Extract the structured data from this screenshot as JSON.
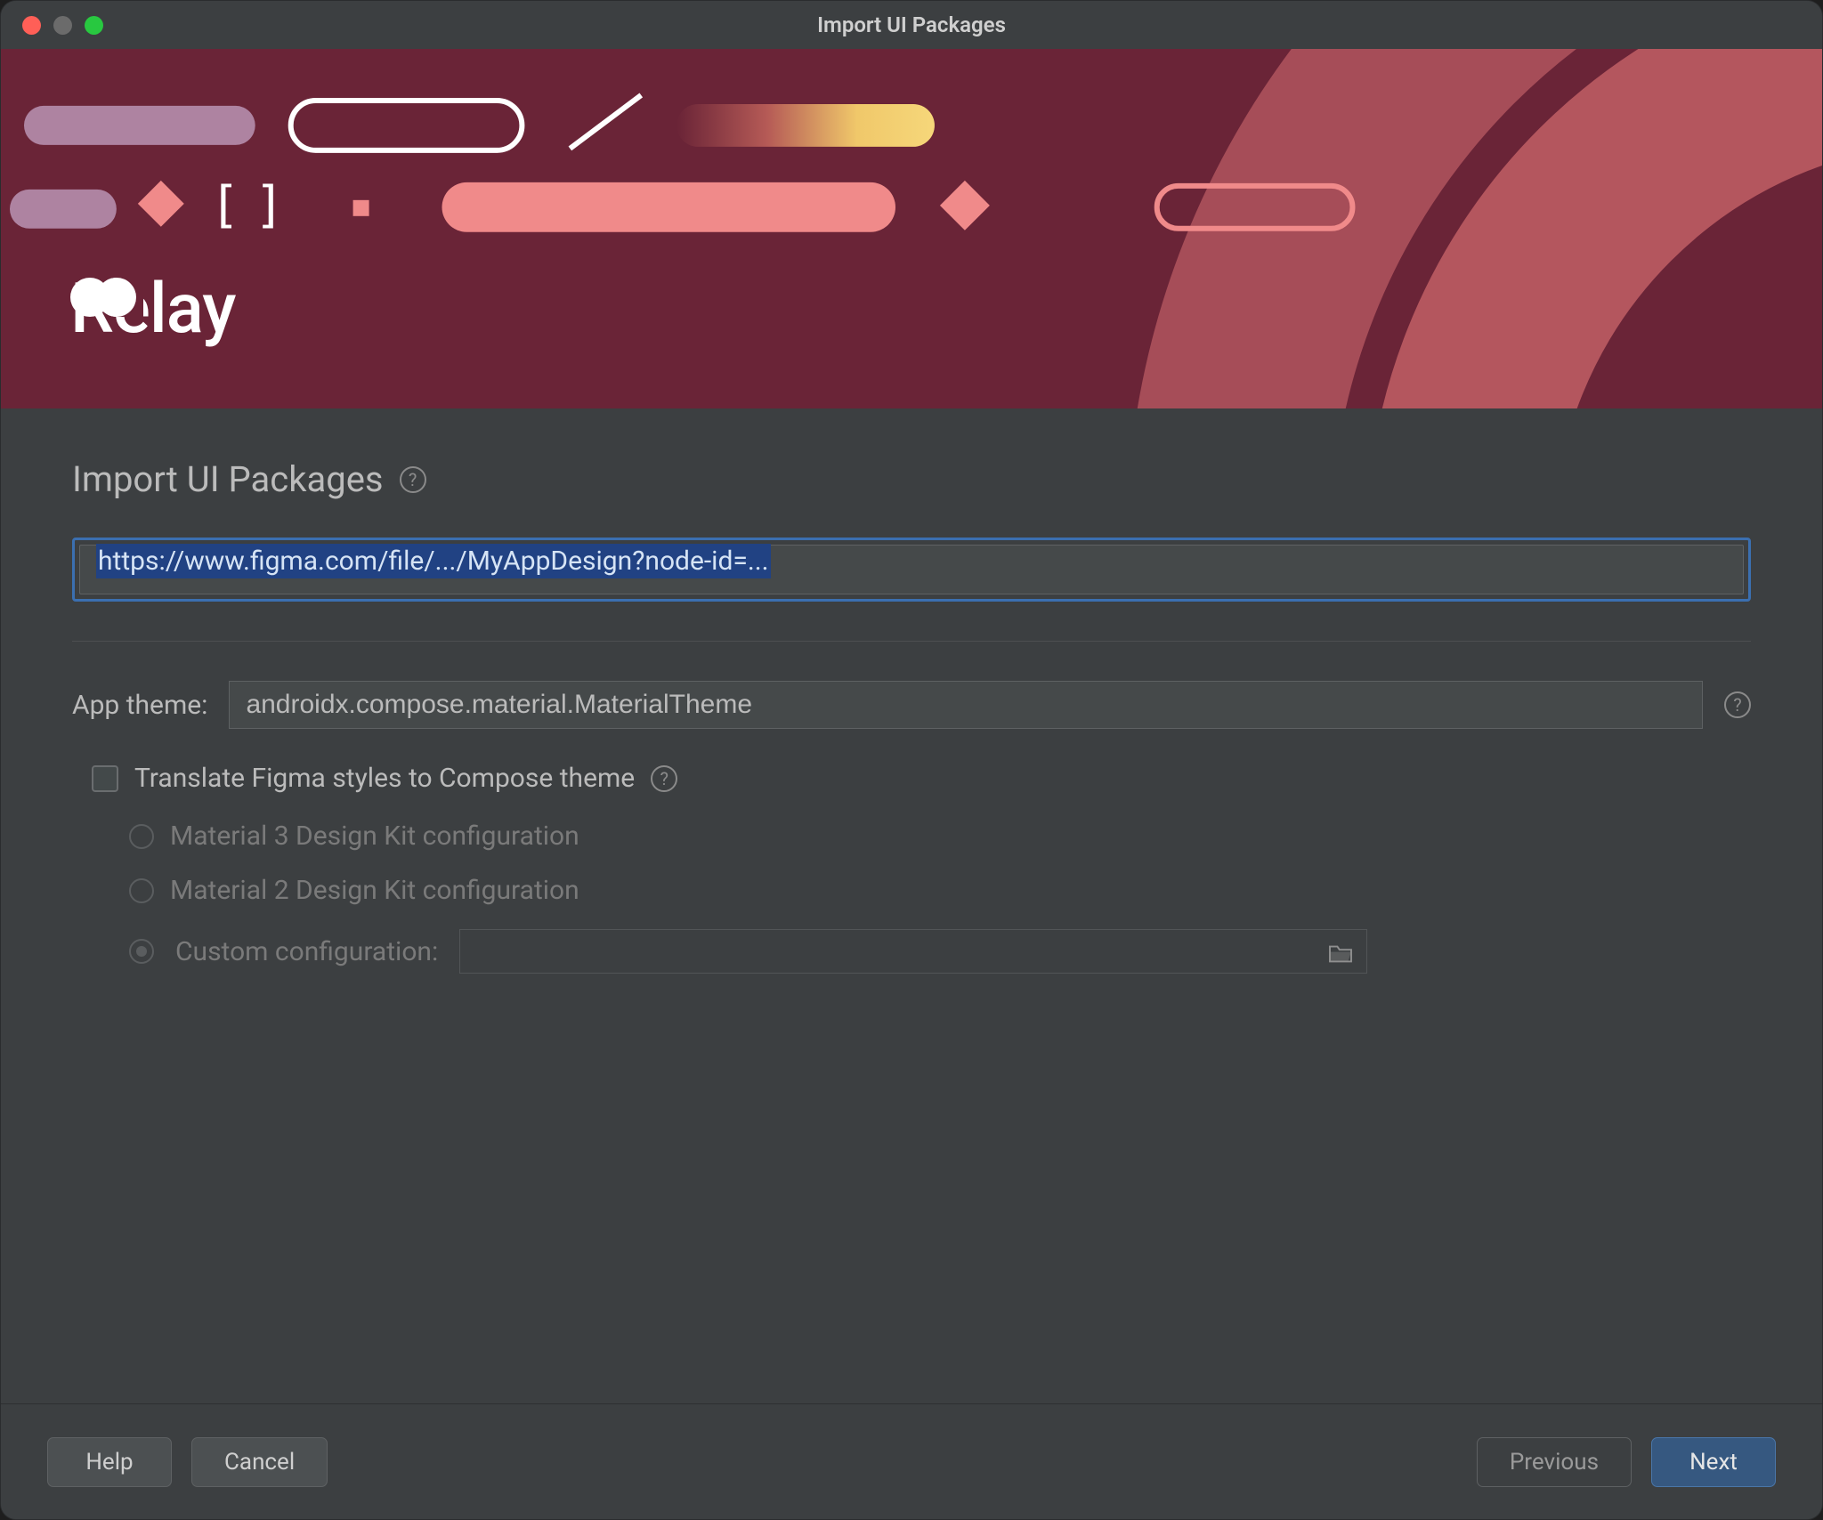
{
  "window": {
    "title": "Import UI Packages"
  },
  "banner": {
    "brand": "Relay"
  },
  "main": {
    "heading": "Import UI Packages",
    "url_value": "https://www.figma.com/file/.../MyAppDesign?node-id=...",
    "theme_label": "App theme:",
    "theme_value": "androidx.compose.material.MaterialTheme",
    "translate_label": "Translate Figma styles to Compose theme",
    "translate_checked": false,
    "radios": {
      "m3": "Material 3 Design Kit configuration",
      "m2": "Material 2 Design Kit configuration",
      "custom": "Custom configuration:",
      "selected": "custom"
    }
  },
  "footer": {
    "help": "Help",
    "cancel": "Cancel",
    "previous": "Previous",
    "next": "Next"
  }
}
